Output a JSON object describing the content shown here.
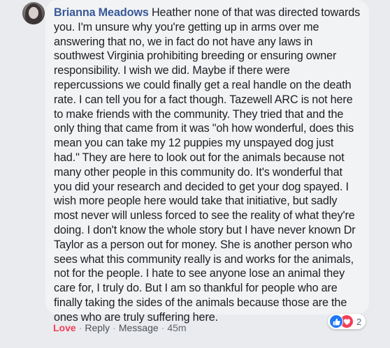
{
  "comment": {
    "author": "Brianna Meadows",
    "body": "Heather none of that was directed towards you. I'm unsure why you're getting up in arms over me answering that no, we in fact do not have any laws in southwest Virginia prohibiting breeding or ensuring owner responsibility. I wish we did. Maybe if there were repercussions we could finally get a real handle on the death rate. I can tell you for a fact though. Tazewell ARC is not here to make friends with the community. They tried that and the only thing that came from it was \"oh how wonderful, does this mean you can take my 12 puppies my unspayed dog just had.\" They are here to look out for the animals because not many other people in this community do. It's wonderful that you did your research and decided to get your dog spayed. I wish more people here would take that initiative, but sadly most never will unless forced to see the reality of what they're doing. I don't know the whole story but I have never known Dr Taylor as a person out for money. She is another person who sees what this community really is and works for the animals, not for the people. I hate to see anyone lose an animal they care for, I truly do. But I am so thankful for people who are finally taking the sides of the animals because those are the ones who are truly suffering here.",
    "reactions": {
      "icons": [
        "like-icon",
        "heart-icon"
      ],
      "count": "2"
    }
  },
  "actions": {
    "love_label": "Love",
    "reply_label": "Reply",
    "message_label": "Message",
    "separator": "·",
    "time": "45m"
  },
  "colors": {
    "author": "#385898",
    "love": "#f33e58",
    "like": "#2078f4",
    "bubble": "#f2f3f5"
  }
}
